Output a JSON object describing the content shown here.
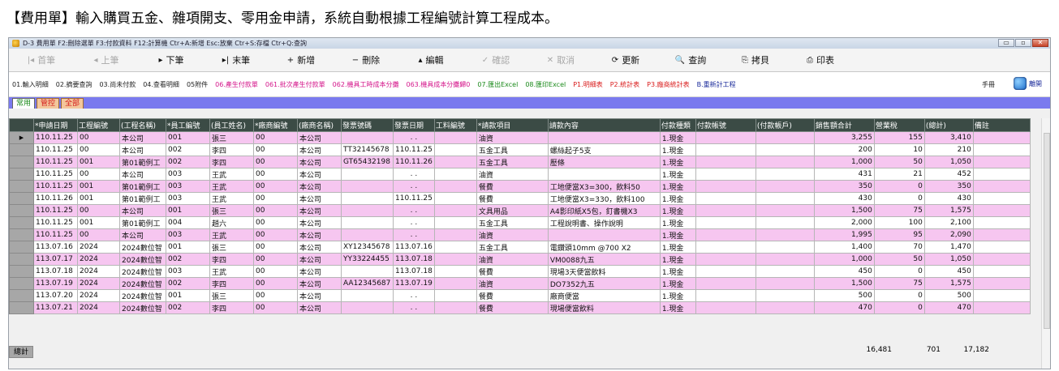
{
  "heading": "【費用單】輸入購買五金、雜項開支、零用金申請，系統自動根據工程編號計算工程成本。",
  "window": {
    "title": "D-3 費用單 F2:刪除選單 F3:付款資料 F12:計算機 Ctr+A:新增 Esc:放棄 Ctr+S:存檔 Ctr+Q:查詢",
    "controls": [
      "▭",
      "▫",
      "✕"
    ]
  },
  "toolbar": [
    {
      "icon": "|◂",
      "label": "首筆",
      "enabled": false,
      "name": "first-record-button"
    },
    {
      "icon": "◂",
      "label": "上筆",
      "enabled": false,
      "name": "prev-record-button"
    },
    {
      "icon": "▸",
      "label": "下筆",
      "enabled": true,
      "name": "next-record-button"
    },
    {
      "icon": "▸|",
      "label": "末筆",
      "enabled": true,
      "name": "last-record-button"
    },
    {
      "icon": "+",
      "label": "新增",
      "enabled": true,
      "name": "add-button"
    },
    {
      "icon": "−",
      "label": "刪除",
      "enabled": true,
      "name": "delete-button"
    },
    {
      "icon": "▴",
      "label": "編輯",
      "enabled": true,
      "name": "edit-button"
    },
    {
      "icon": "✓",
      "label": "確認",
      "enabled": false,
      "name": "confirm-button"
    },
    {
      "icon": "✕",
      "label": "取消",
      "enabled": false,
      "name": "cancel-button"
    },
    {
      "icon": "⟳",
      "label": "更新",
      "enabled": true,
      "name": "refresh-button"
    },
    {
      "icon": "🔍",
      "label": "查詢",
      "enabled": true,
      "name": "query-button"
    },
    {
      "icon": "⎘",
      "label": "拷貝",
      "enabled": true,
      "name": "copy-button"
    },
    {
      "icon": "⎙",
      "label": "印表",
      "enabled": true,
      "name": "print-button"
    }
  ],
  "functions": [
    {
      "label": "01.輸入明細",
      "color": "black"
    },
    {
      "label": "02.摘要查詢",
      "color": "black"
    },
    {
      "label": "03.尚未付款",
      "color": "black"
    },
    {
      "label": "04.查看明細",
      "color": "black"
    },
    {
      "label": "05附件",
      "color": "black"
    },
    {
      "label": "06.產生付款單",
      "color": "magenta"
    },
    {
      "label": "061.批次產生付款單",
      "color": "magenta"
    },
    {
      "label": "062.機具工時成本分攤",
      "color": "magenta"
    },
    {
      "label": "063.機具成本分攤歸0",
      "color": "magenta"
    },
    {
      "label": "07.匯出Excel",
      "color": "green"
    },
    {
      "label": "08.匯印Excel",
      "color": "green"
    },
    {
      "label": "P1.明細表",
      "color": "red"
    },
    {
      "label": "P2.統計表",
      "color": "red"
    },
    {
      "label": "P3.廠商統計表",
      "color": "red"
    },
    {
      "label": "B.重新計工程",
      "color": "navy"
    }
  ],
  "manual_label": "手冊",
  "exit_label": "離開",
  "tabs": [
    {
      "label": "常用",
      "active": true,
      "red": false
    },
    {
      "label": "管控",
      "active": false,
      "red": true
    },
    {
      "label": "全部",
      "active": false,
      "red": true
    }
  ],
  "columns": [
    "*申請日期",
    "工程編號",
    "(工程名稱)",
    "*員工編號",
    "(員工姓名)",
    "*廠商編號",
    "(廠商名稱)",
    "發票號碼",
    "發票日期",
    "工料編號",
    "*請款項目",
    "請款內容",
    "付款種類",
    "付款帳號",
    "(付款帳戶)",
    "銷售額合計",
    "營業稅",
    "(總計)",
    "備註"
  ],
  "rows": [
    [
      "110.11.25",
      "00",
      "本公司",
      "001",
      "張三",
      "00",
      "本公司",
      "",
      " . .",
      "",
      "油資",
      "",
      "1.現金",
      "",
      "",
      "3,255",
      "155",
      "3,410",
      ""
    ],
    [
      "110.11.25",
      "00",
      "本公司",
      "002",
      "李四",
      "00",
      "本公司",
      "TT32145678",
      "110.11.25",
      "",
      "五金工具",
      "螺絲起子5支",
      "1.現金",
      "",
      "",
      "200",
      "10",
      "210",
      ""
    ],
    [
      "110.11.25",
      "001",
      "第01範例工",
      "002",
      "李四",
      "00",
      "本公司",
      "GT65432198",
      "110.11.26",
      "",
      "五金工具",
      "壓條",
      "1.現金",
      "",
      "",
      "1,000",
      "50",
      "1,050",
      ""
    ],
    [
      "110.11.25",
      "00",
      "本公司",
      "003",
      "王武",
      "00",
      "本公司",
      "",
      " . .",
      "",
      "油資",
      "",
      "1.現金",
      "",
      "",
      "431",
      "21",
      "452",
      ""
    ],
    [
      "110.11.25",
      "001",
      "第01範例工",
      "003",
      "王武",
      "00",
      "本公司",
      "",
      " . .",
      "",
      "餐費",
      "工地便當X3=300，飲料50",
      "1.現金",
      "",
      "",
      "350",
      "0",
      "350",
      ""
    ],
    [
      "110.11.26",
      "001",
      "第01範例工",
      "003",
      "王武",
      "00",
      "本公司",
      "",
      "110.11.25",
      "",
      "餐費",
      "工地便當X3=330，飲料100",
      "1.現金",
      "",
      "",
      "430",
      "0",
      "430",
      ""
    ],
    [
      "110.11.25",
      "00",
      "本公司",
      "001",
      "張三",
      "00",
      "本公司",
      "",
      " . .",
      "",
      "文具用品",
      "A4影印紙X5包，釘書機X3",
      "1.現金",
      "",
      "",
      "1,500",
      "75",
      "1,575",
      ""
    ],
    [
      "110.11.25",
      "001",
      "第01範例工",
      "004",
      "趙六",
      "00",
      "本公司",
      "",
      " . .",
      "",
      "五金工具",
      "工程說明書、操作說明",
      "1.現金",
      "",
      "",
      "2,000",
      "100",
      "2,100",
      ""
    ],
    [
      "110.11.25",
      "00",
      "本公司",
      "003",
      "王武",
      "00",
      "本公司",
      "",
      " . .",
      "",
      "油資",
      "",
      "1.現金",
      "",
      "",
      "1,995",
      "95",
      "2,090",
      ""
    ],
    [
      "113.07.16",
      "2024",
      "2024數位智",
      "001",
      "張三",
      "00",
      "本公司",
      "XY12345678",
      "113.07.16",
      "",
      "五金工具",
      "電鑽頭10mm @700 X2",
      "1.現金",
      "",
      "",
      "1,400",
      "70",
      "1,470",
      ""
    ],
    [
      "113.07.17",
      "2024",
      "2024數位智",
      "002",
      "李四",
      "00",
      "本公司",
      "YY33224455",
      "113.07.18",
      "",
      "油資",
      "VM0088九五",
      "1.現金",
      "",
      "",
      "1,000",
      "50",
      "1,050",
      ""
    ],
    [
      "113.07.18",
      "2024",
      "2024數位智",
      "003",
      "王武",
      "00",
      "本公司",
      "",
      "113.07.18",
      "",
      "餐費",
      "現場3天便當飲料",
      "1.現金",
      "",
      "",
      "450",
      "0",
      "450",
      ""
    ],
    [
      "113.07.19",
      "2024",
      "2024數位智",
      "002",
      "李四",
      "00",
      "本公司",
      "AA12345687",
      "113.07.19",
      "",
      "油資",
      "DO7352九五",
      "1.現金",
      "",
      "",
      "1,500",
      "75",
      "1,575",
      ""
    ],
    [
      "113.07.20",
      "2024",
      "2024數位智",
      "001",
      "張三",
      "00",
      "本公司",
      "",
      " . .",
      "",
      "餐費",
      "廠商便當",
      "1.現金",
      "",
      "",
      "500",
      "0",
      "500",
      ""
    ],
    [
      "113.07.21",
      "2024",
      "2024數位智",
      "002",
      "李四",
      "00",
      "本公司",
      "",
      " . .",
      "",
      "餐費",
      "現場便當飲料",
      "1.現金",
      "",
      "",
      "470",
      "0",
      "470",
      ""
    ]
  ],
  "totals": {
    "label": "總計",
    "sales": "16,481",
    "tax": "701",
    "total": "17,182"
  }
}
